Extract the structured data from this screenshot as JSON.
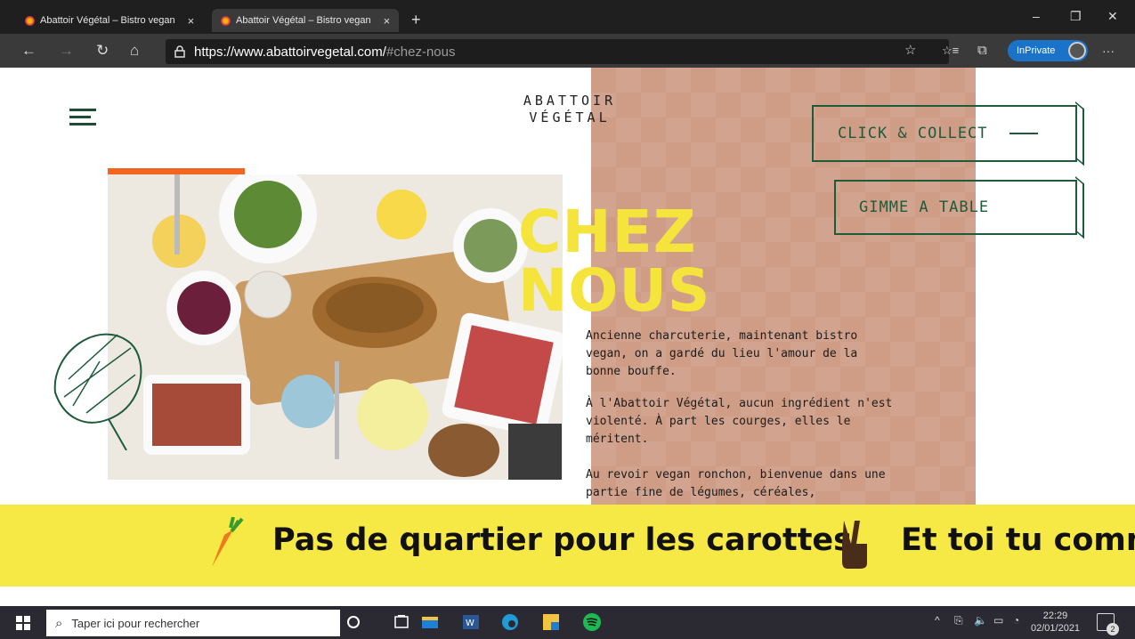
{
  "browser": {
    "tabs": [
      {
        "title": "Abattoir Végétal – Bistro vegan",
        "close": "×"
      },
      {
        "title": "Abattoir Végétal – Bistro vegan",
        "close": "×"
      }
    ],
    "new_tab": "+",
    "window_controls": {
      "minimize": "–",
      "restore": "❐",
      "close": "✕"
    },
    "nav": {
      "back": "←",
      "forward": "→",
      "refresh": "↻",
      "home": "⌂"
    },
    "url": {
      "host": "https://www.abattoirvegetal.com/",
      "fragment": "#chez-nous"
    },
    "toolbar": {
      "favorite": "☆",
      "favorites": "☆≡",
      "collections": "⧉",
      "more": "···"
    },
    "inprivate_label": "InPrivate"
  },
  "site": {
    "logo_line1": "ABATTOIR",
    "logo_line2": "VÉGÉTAL",
    "click_collect": "CLICK & COLLECT",
    "gimme_table": "GIMME A TABLE",
    "title_line1": "CHEZ",
    "title_line2": "NOUS",
    "paragraphs": [
      "Ancienne charcuterie, maintenant bistro vegan, on a gardé du lieu l'amour de la bonne bouffe.",
      "À l'Abattoir Végétal, aucun ingrédient n'est violenté. À part les courges, elles le méritent.",
      "Au revoir vegan ronchon, bienvenue dans une partie fine de légumes, céréales,"
    ],
    "banner": {
      "text1": "Pas de quartier pour les carottes",
      "text2": "Et toi tu comm"
    },
    "colors": {
      "accent_green": "#1d5b3b",
      "title_yellow": "#f5e43c",
      "panel_pink": "#cf9d86",
      "banner_yellow": "#f6e845",
      "accent_orange": "#f2661f"
    }
  },
  "taskbar": {
    "search_placeholder": "Taper ici pour rechercher",
    "time": "22:29",
    "date": "02/01/2021",
    "notification_count": "2"
  }
}
